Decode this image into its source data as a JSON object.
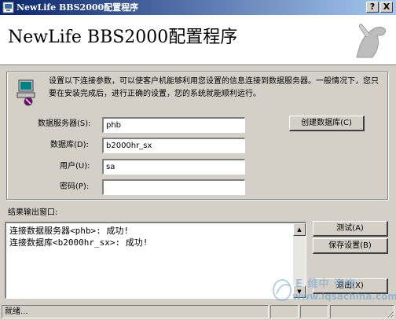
{
  "window": {
    "title": "NewLife BBS2000配置程序",
    "help_glyph": "?",
    "close_glyph": "X"
  },
  "header": {
    "title": "NewLife BBS2000配置程序"
  },
  "connection": {
    "intro": "设置以下连接参数，可以使客户机能够利用您设置的信息连接到数据服务器。一般情况下，您只要在安装完成后，进行正确的设置，您的系统就能顺利运行。",
    "server_label": "数据服务器(S):",
    "server_value": "phb",
    "database_label": "数据库(D):",
    "database_value": "b2000hr_sx",
    "user_label": "用户(U):",
    "user_value": "sa",
    "password_label": "密码(P):",
    "password_value": "",
    "create_db_button": "创建数据库(C)"
  },
  "output": {
    "label": "结果输出窗口:",
    "lines": [
      "连接数据服务器<phb>: 成功!",
      "连接数据库<b2000hr_sx>: 成功!"
    ]
  },
  "buttons": {
    "test": "测试(A)",
    "save": "保存设置(B)",
    "exit": "退出(X)"
  },
  "statusbar": {
    "text": "就绪..."
  },
  "watermark": {
    "text": "E 维中 咨询",
    "url": "www.iqsachina.com"
  },
  "colors": {
    "titlebar_start": "#0a246a",
    "titlebar_end": "#a6caf0",
    "face": "#d4d0c8"
  }
}
